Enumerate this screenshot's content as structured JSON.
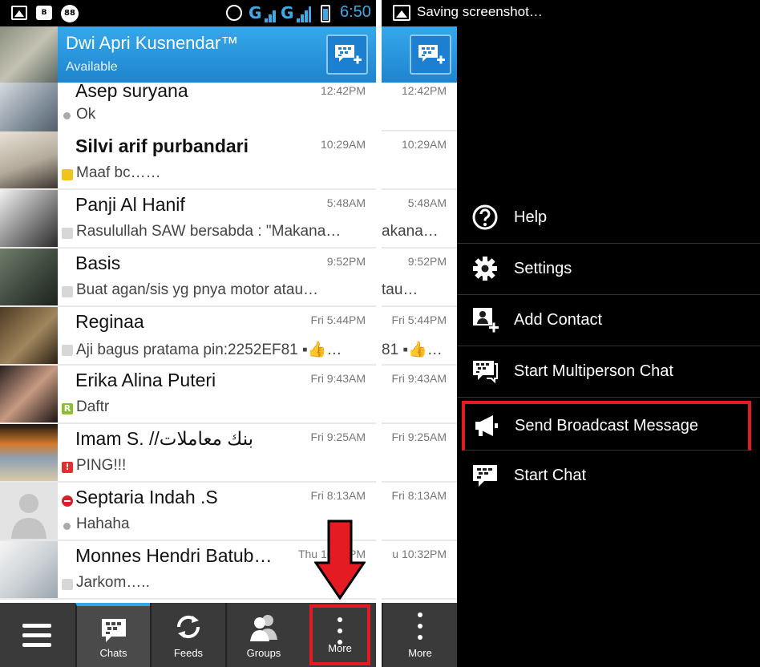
{
  "status_bar": {
    "badge_count": "88",
    "network_1": "G",
    "network_2": "G",
    "time": "6:50"
  },
  "profile": {
    "name": "Dwi Apri Kusnendar™",
    "status": "Available"
  },
  "chats": [
    {
      "name": "Asep suryana",
      "time": "12:42PM",
      "message": "Ok",
      "marker": "dot",
      "bold": false
    },
    {
      "name": "Silvi arif purbandari",
      "time": "10:29AM",
      "message": "Maaf bc……",
      "marker": "broadcast-yellow",
      "bold": true
    },
    {
      "name": "Panji Al Hanif",
      "time": "5:48AM",
      "message": "Rasulullah SAW bersabda : \"Makana…",
      "marker": "broadcast",
      "bold": false
    },
    {
      "name": "Basis",
      "time": "9:52PM",
      "message": "Buat agan/sis yg pnya motor atau…",
      "marker": "broadcast",
      "bold": false
    },
    {
      "name": "Reginaa",
      "time": "Fri 5:44PM",
      "message": "Aji bagus pratama pin:2252EF81 ▪👍…",
      "marker": "broadcast",
      "bold": false
    },
    {
      "name": "Erika Alina Puteri",
      "time": "Fri 9:43AM",
      "message": "Daftr",
      "marker": "R",
      "bold": false
    },
    {
      "name": "Imam S. //بنك معاملات",
      "time": "Fri 9:25AM",
      "message": "PING!!!",
      "marker": "!",
      "bold": false
    },
    {
      "name": "Septaria Indah .S",
      "time": "Fri 8:13AM",
      "message": "Hahaha",
      "marker": "dot",
      "bold": false
    },
    {
      "name": "Monnes Hendri Batub…",
      "time": "Thu 10:32PM",
      "message": "Jarkom…..",
      "marker": "broadcast",
      "bold": false
    }
  ],
  "mid_strip": {
    "times": [
      "12:42PM",
      "10:29AM",
      "5:48AM",
      "9:52PM",
      "Fri 5:44PM",
      "Fri 9:43AM",
      "Fri 9:25AM",
      "Fri 8:13AM",
      "u 10:32PM"
    ],
    "messages": [
      "",
      "",
      "akana…",
      "tau…",
      "81 ▪👍…",
      "",
      "",
      "",
      ""
    ]
  },
  "tabs": {
    "chats": "Chats",
    "feeds": "Feeds",
    "groups": "Groups",
    "more": "More",
    "more_mid": "More"
  },
  "notification": {
    "text": "Saving screenshot…"
  },
  "menu": {
    "items": [
      {
        "label": "Help",
        "icon": "help-icon"
      },
      {
        "label": "Settings",
        "icon": "gear-icon"
      },
      {
        "label": "Add Contact",
        "icon": "add-contact-icon"
      },
      {
        "label": "Start Multiperson Chat",
        "icon": "multiperson-chat-icon"
      },
      {
        "label": "Send Broadcast Message",
        "icon": "megaphone-icon"
      },
      {
        "label": "Start Chat",
        "icon": "bbm-chat-icon"
      }
    ]
  },
  "colors": {
    "accent": "#2fa7e9",
    "header": "#1e84cf",
    "highlight": "#e51b24"
  }
}
